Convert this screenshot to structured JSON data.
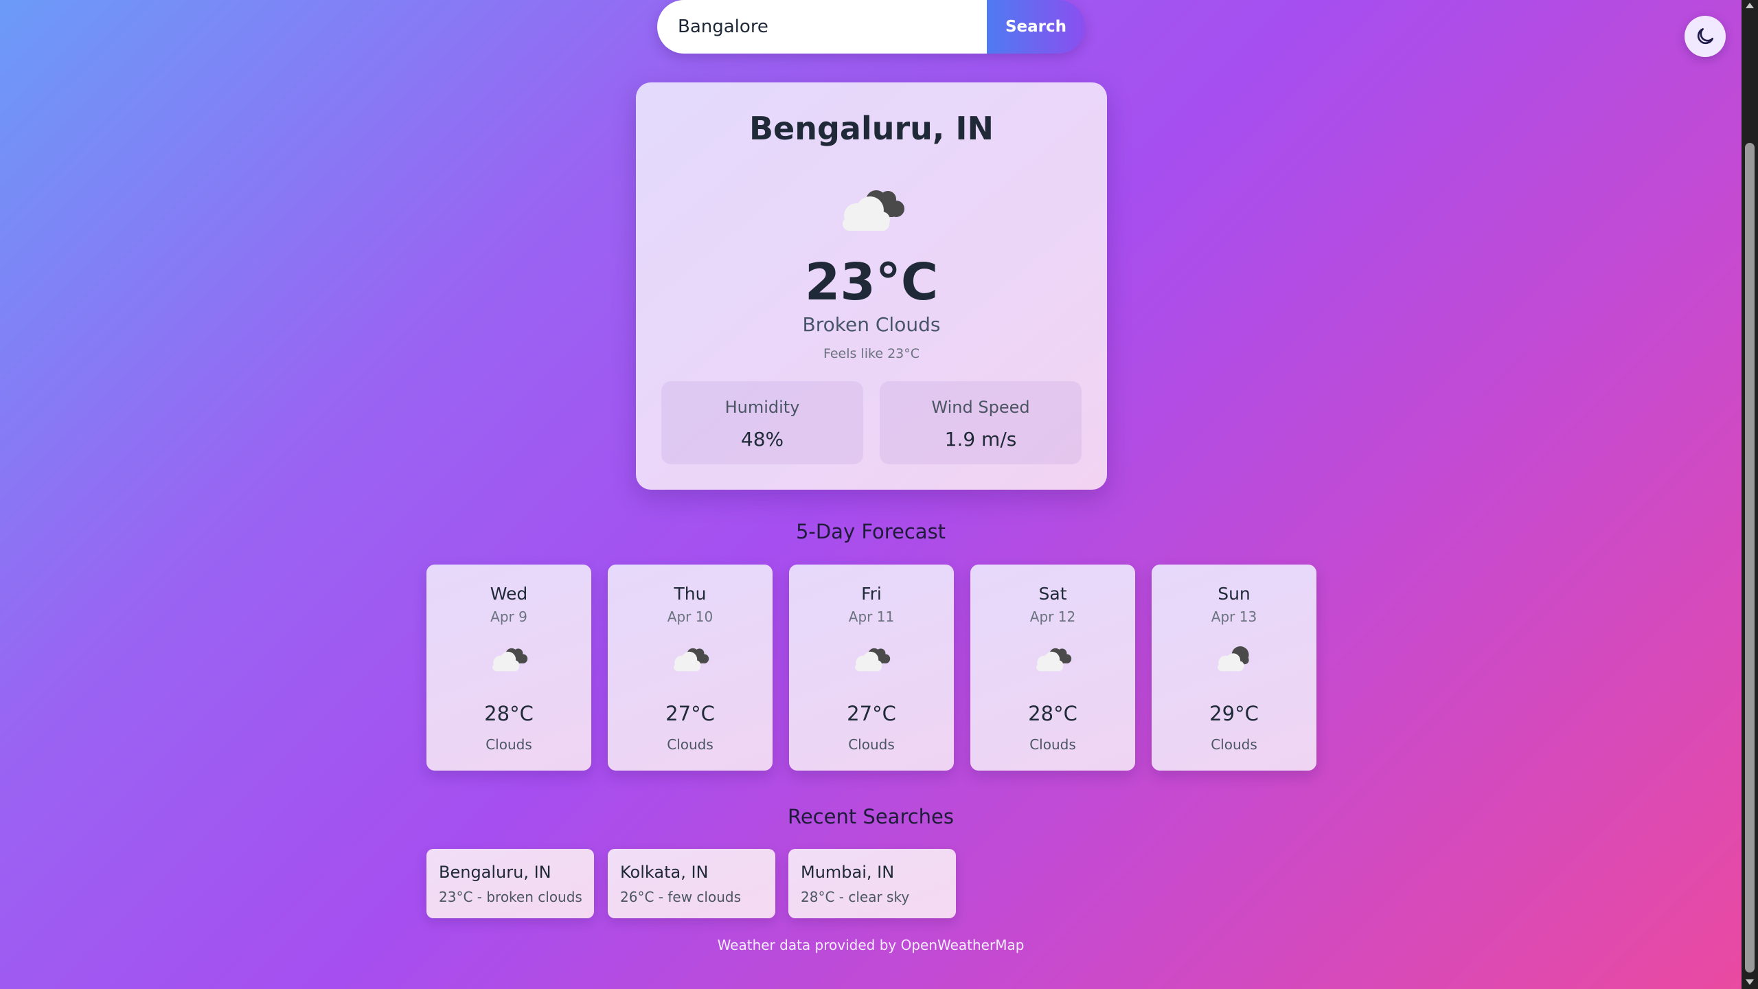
{
  "search": {
    "value": "Bangalore",
    "button_label": "Search"
  },
  "theme_toggle": {
    "icon": "moon-icon"
  },
  "current": {
    "city": "Bengaluru, IN",
    "icon": "broken-clouds-icon",
    "temperature": "23°C",
    "condition": "Broken Clouds",
    "feels_like": "Feels like 23°C",
    "humidity_label": "Humidity",
    "humidity_value": "48%",
    "wind_label": "Wind Speed",
    "wind_value": "1.9 m/s"
  },
  "forecast": {
    "title": "5-Day Forecast",
    "days": [
      {
        "day": "Wed",
        "date": "Apr 9",
        "temp": "28°C",
        "condition": "Clouds",
        "icon": "broken-clouds-icon"
      },
      {
        "day": "Thu",
        "date": "Apr 10",
        "temp": "27°C",
        "condition": "Clouds",
        "icon": "broken-clouds-icon"
      },
      {
        "day": "Fri",
        "date": "Apr 11",
        "temp": "27°C",
        "condition": "Clouds",
        "icon": "broken-clouds-icon"
      },
      {
        "day": "Sat",
        "date": "Apr 12",
        "temp": "28°C",
        "condition": "Clouds",
        "icon": "broken-clouds-icon"
      },
      {
        "day": "Sun",
        "date": "Apr 13",
        "temp": "29°C",
        "condition": "Clouds",
        "icon": "overcast-clouds-icon"
      }
    ]
  },
  "recent": {
    "title": "Recent Searches",
    "items": [
      {
        "city": "Bengaluru, IN",
        "detail": "23°C - broken clouds"
      },
      {
        "city": "Kolkata, IN",
        "detail": "26°C - few clouds"
      },
      {
        "city": "Mumbai, IN",
        "detail": "28°C - clear sky"
      }
    ]
  },
  "footer": {
    "text": "Weather data provided by OpenWeatherMap"
  },
  "colors": {
    "accent_start": "#4f7bf1",
    "accent_end": "#8b4ff0",
    "cloud_dark": "#4a4a4a",
    "cloud_light": "#f2f2f2"
  }
}
